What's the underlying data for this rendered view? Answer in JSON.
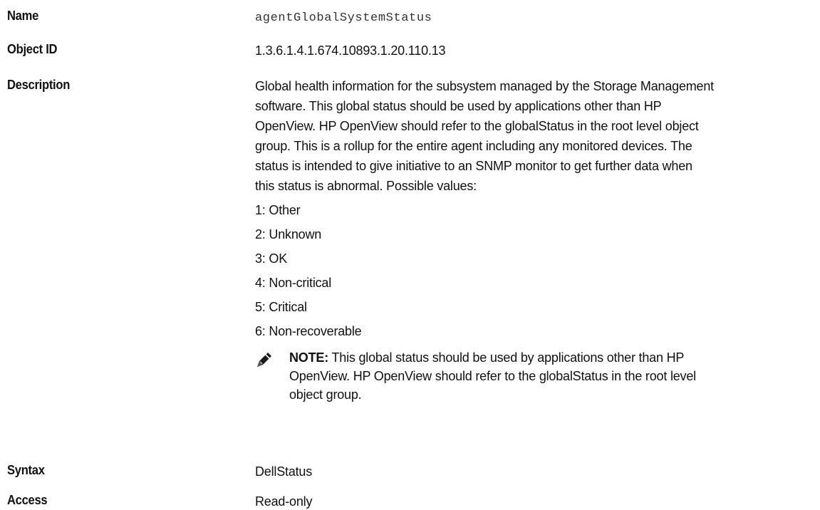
{
  "rows": {
    "name": {
      "label": "Name",
      "value": "agentGlobalSystemStatus"
    },
    "object_id": {
      "label": "Object ID",
      "value": "1.3.6.1.4.1.674.10893.1.20.110.13"
    },
    "description": {
      "label": "Description",
      "lines": [
        "Global health information for the subsystem managed by the Storage Management",
        "software. This global status should be used by applications other than HP",
        "OpenView. HP OpenView should refer to the globalStatus in the root level object",
        "group. This is a rollup for the entire agent including any monitored devices. The",
        "status is intended to give initiative to an SNMP monitor to get further data when",
        "this status is abnormal. Possible values:"
      ],
      "values": [
        "1: Other",
        "2: Unknown",
        "3: OK",
        "4: Non-critical",
        "5: Critical",
        "6: Non-recoverable"
      ],
      "note": {
        "icon": "note-pencil-icon",
        "label": "NOTE:",
        "lines": [
          "This global status should be used by applications other than HP",
          "OpenView. HP OpenView should refer to the globalStatus in the root level",
          "object group."
        ]
      }
    },
    "syntax": {
      "label": "Syntax",
      "value": "DellStatus"
    },
    "access": {
      "label": "Access",
      "value": "Read-only"
    }
  }
}
